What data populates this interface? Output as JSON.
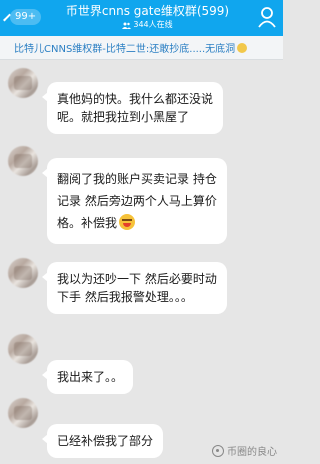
{
  "header": {
    "unread_badge": "99+",
    "title": "币世界cnns gate维权群(599)",
    "online_text": "344人在线",
    "colors": {
      "bar": "#10a6ee",
      "text": "#ffffff"
    },
    "icons": {
      "back": "chevron-left-icon",
      "members": "person-icon",
      "online": "users-icon"
    }
  },
  "notice": {
    "text": "比特儿CNNS维权群-比特二世:还敢抄底.....无底洞",
    "emoji_icon": "smile-emoji-icon"
  },
  "messages": [
    {
      "lines": [
        "真他妈的快。我什么都还没说",
        "呢。就把我拉到小黑屋了"
      ]
    },
    {
      "lines": [
        "翻阅了我的账户买卖记录 持仓",
        "记录 然后旁边两个人马上算价",
        "格。补偿我"
      ],
      "emoji": "crying-face-icon"
    },
    {
      "lines": [
        "我以为还吵一下 然后必要时动",
        "下手 然后我报警处理。。。"
      ]
    },
    {
      "lines": [
        "我出来了。。"
      ]
    },
    {
      "lines": [
        "已经补偿我了部分"
      ]
    }
  ],
  "watermark": {
    "text": "币圈的良心",
    "icon": "wechat-official-icon"
  }
}
